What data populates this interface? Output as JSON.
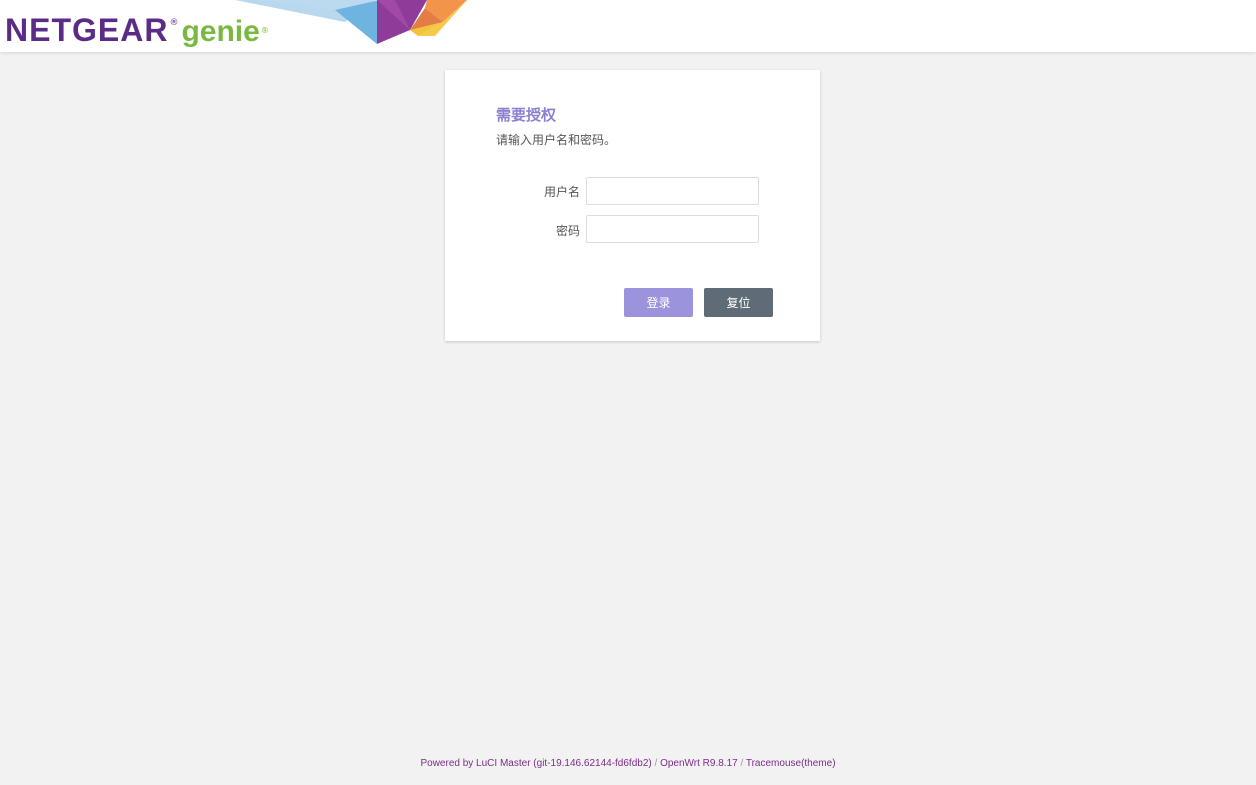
{
  "header": {
    "logo_text": "NETGEAR",
    "logo_reg": "®",
    "logo_genie": "genie",
    "logo_genie_reg": "®"
  },
  "login": {
    "title": "需要授权",
    "description": "请输入用户名和密码。",
    "username_label": "用户名",
    "username_value": "",
    "password_label": "密码",
    "password_value": "",
    "login_button": "登录",
    "reset_button": "复位"
  },
  "footer": {
    "luci_link": "Powered by LuCI Master (git-19.146.62144-fd6fdb2)",
    "separator": " / ",
    "openwrt_link": "OpenWrt R9.8.17",
    "theme_link": "Tracemouse(theme)"
  },
  "colors": {
    "brand_purple": "#5b2c87",
    "brand_green": "#79b941",
    "title_accent": "#8a82d1",
    "login_button": "#9c93dd",
    "reset_button": "#5f6b76",
    "footer_link": "#7d2d8a"
  },
  "icons": [
    "netgear-genie-logo",
    "banner-polygon-art"
  ]
}
